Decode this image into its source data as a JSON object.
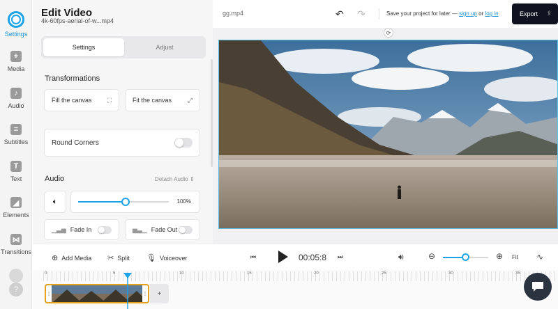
{
  "rail": {
    "items": [
      {
        "label": "Settings",
        "icon": "settings-icon",
        "active": true
      },
      {
        "label": "Media",
        "icon": "plus-icon"
      },
      {
        "label": "Audio",
        "icon": "music-note-icon"
      },
      {
        "label": "Subtitles",
        "icon": "subtitles-icon"
      },
      {
        "label": "Text",
        "icon": "text-icon"
      },
      {
        "label": "Elements",
        "icon": "elements-icon"
      },
      {
        "label": "Transitions",
        "icon": "transitions-icon"
      }
    ],
    "help_symbol": "?"
  },
  "panel": {
    "title": "Edit Video",
    "filename": "4k-60fps-aerial-of-w...mp4",
    "tabs": [
      "Settings",
      "Adjust"
    ],
    "transformations_label": "Transformations",
    "fill_canvas": "Fill the canvas",
    "fit_canvas": "Fit the canvas",
    "round_corners": "Round Corners",
    "audio_label": "Audio",
    "detach_audio": "Detach Audio",
    "volume_percent": "100%",
    "volume_level": 0.52,
    "fade_in": "Fade In",
    "fade_out": "Fade Out"
  },
  "topbar": {
    "project_file": "gg.mp4",
    "save_prefix": "Save your project for later —",
    "sign_up": "sign up",
    "or": "or",
    "log_in": "log in",
    "export_label": "Export"
  },
  "toolbar": {
    "add_media": "Add Media",
    "split": "Split",
    "voiceover": "Voiceover",
    "time": "00:05:8",
    "fit": "Fit",
    "zoom_level": 0.5
  },
  "timeline": {
    "ruler_marks": [
      "0",
      "5",
      "10",
      "15",
      "20",
      "25",
      "30",
      "35"
    ]
  },
  "colors": {
    "accent": "#1aa3e8",
    "export_bg": "#0f1320",
    "clip_border": "#e6a11a"
  }
}
